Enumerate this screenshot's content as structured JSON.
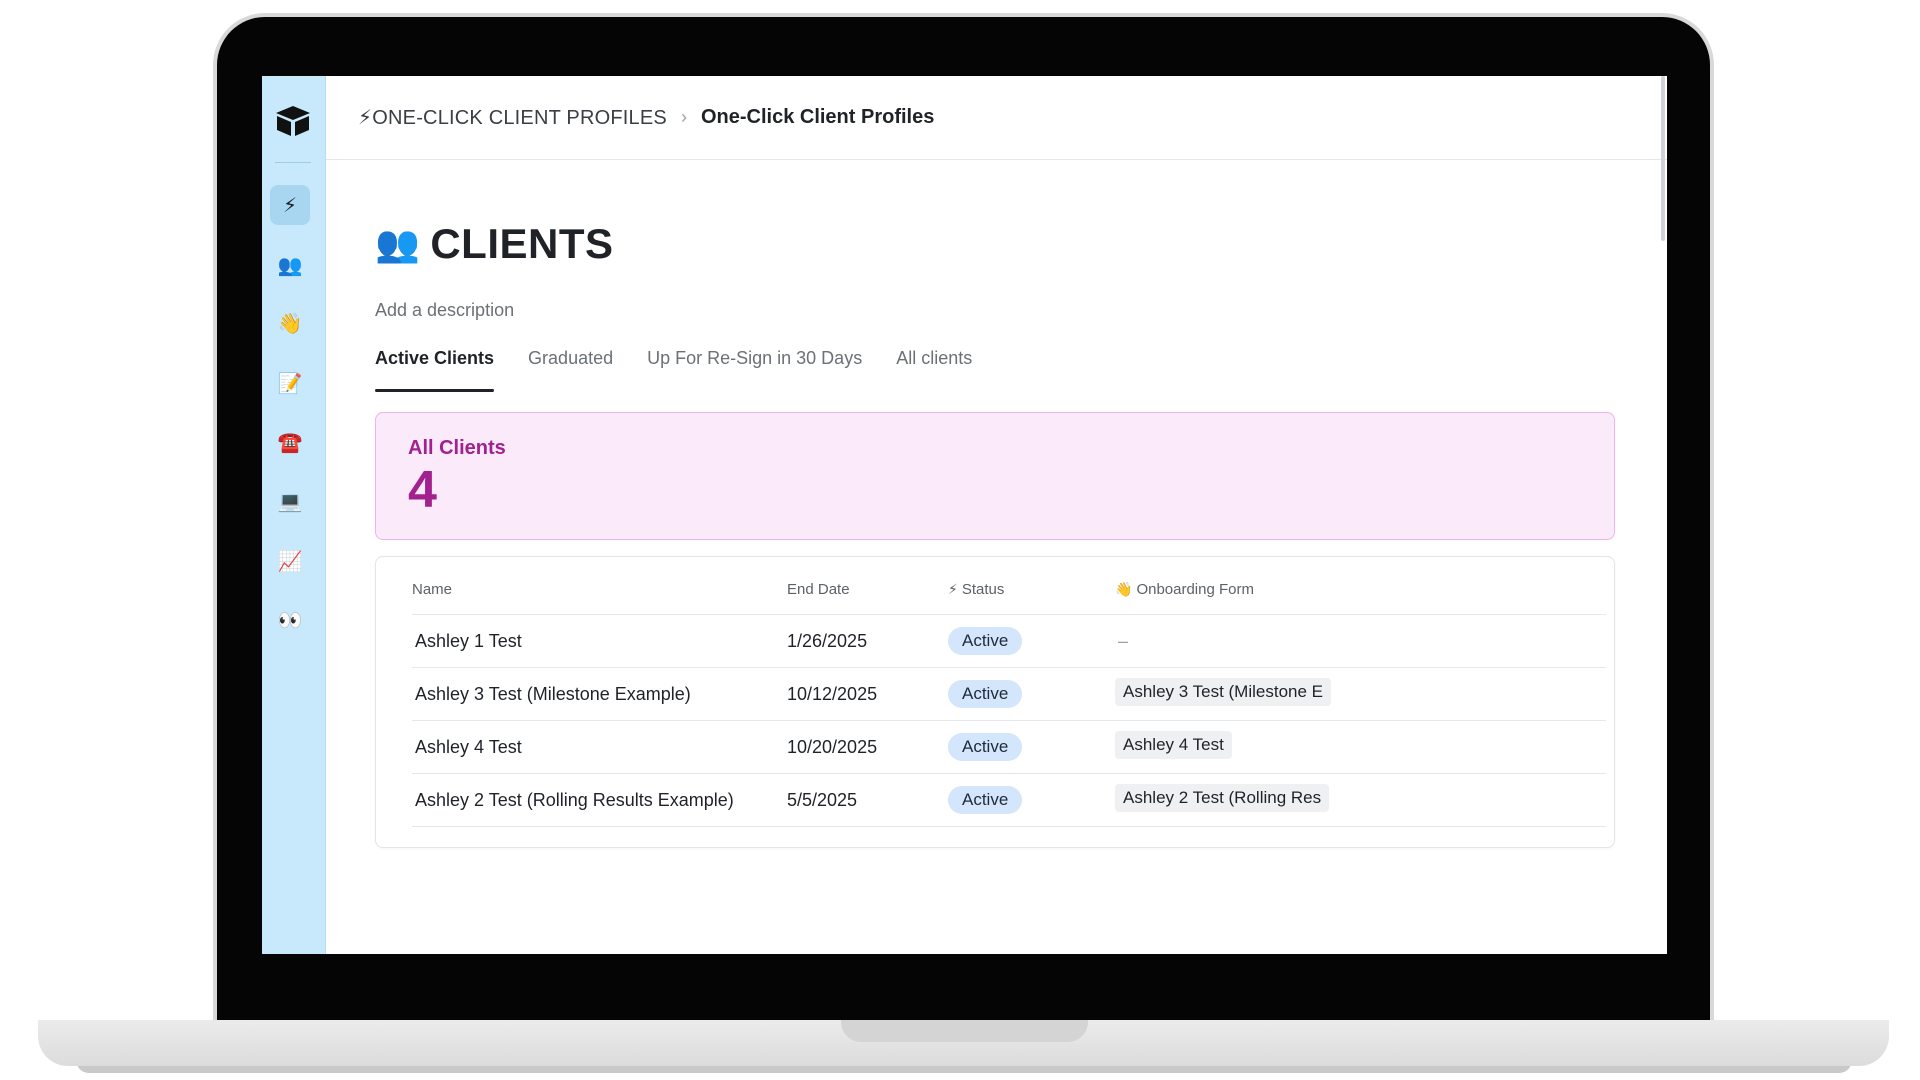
{
  "breadcrumb": {
    "parent_icon": "⚡",
    "parent": "ONE-CLICK CLIENT PROFILES",
    "separator": "›",
    "current": "One-Click Client Profiles"
  },
  "sidebar": {
    "items": [
      {
        "icon": "⚡",
        "icon_name": "lightning-icon"
      },
      {
        "icon": "👥",
        "icon_name": "people-icon"
      },
      {
        "icon": "👋",
        "icon_name": "waving-hand-icon"
      },
      {
        "icon": "📝",
        "icon_name": "memo-icon"
      },
      {
        "icon": "☎️",
        "icon_name": "telephone-icon"
      },
      {
        "icon": "💻",
        "icon_name": "laptop-icon"
      },
      {
        "icon": "📈",
        "icon_name": "chart-increasing-icon"
      },
      {
        "icon": "👀",
        "icon_name": "eyes-icon"
      }
    ]
  },
  "page": {
    "title_icon": "👥",
    "title": "CLIENTS",
    "description": "Add a description"
  },
  "tabs": [
    {
      "label": "Active Clients",
      "active": true
    },
    {
      "label": "Graduated",
      "active": false
    },
    {
      "label": "Up For Re-Sign in 30 Days",
      "active": false
    },
    {
      "label": "All clients",
      "active": false
    }
  ],
  "summary": {
    "label": "All Clients",
    "value": "4"
  },
  "table": {
    "headers": {
      "name": "Name",
      "end_date": "End Date",
      "status_icon": "⚡",
      "status": "Status",
      "form_icon": "👋",
      "form": "Onboarding Form"
    },
    "rows": [
      {
        "name": "Ashley 1 Test",
        "end_date": "1/26/2025",
        "status": "Active",
        "form": "–"
      },
      {
        "name": "Ashley 3 Test (Milestone Example)",
        "end_date": "10/12/2025",
        "status": "Active",
        "form": "Ashley 3 Test (Milestone E"
      },
      {
        "name": "Ashley 4 Test",
        "end_date": "10/20/2025",
        "status": "Active",
        "form": "Ashley 4 Test"
      },
      {
        "name": "Ashley 2 Test (Rolling Results Example)",
        "end_date": "5/5/2025",
        "status": "Active",
        "form": "Ashley 2 Test (Rolling Res"
      }
    ]
  },
  "colors": {
    "sidebar_bg": "#c8e9fb",
    "summary_bg": "#fbeafa",
    "summary_accent": "#a3208f",
    "status_pill": "#d3e6fb"
  }
}
